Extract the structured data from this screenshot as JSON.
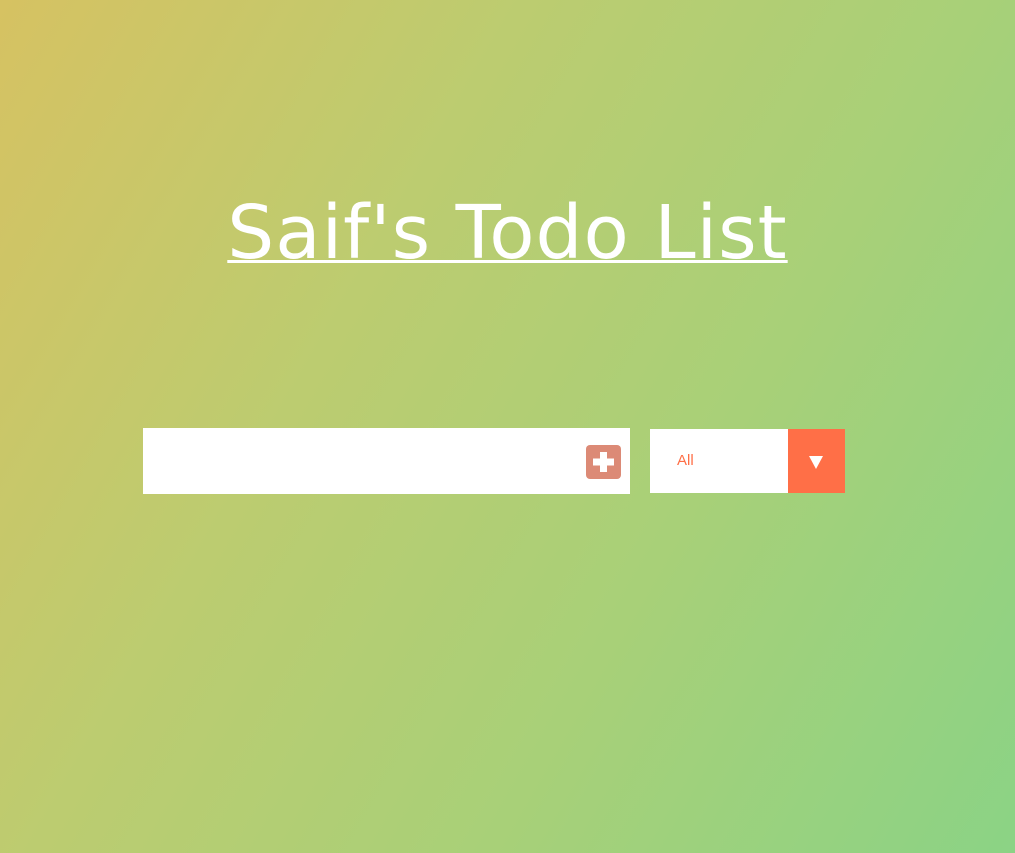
{
  "header": {
    "title": "Saif's Todo List"
  },
  "todo_form": {
    "input_value": "",
    "input_placeholder": "",
    "add_icon": "plus-square-icon"
  },
  "filter": {
    "selected": "All",
    "arrow_icon": "caret-down-icon"
  },
  "colors": {
    "accent": "#ff6f47",
    "add_button": "#dc8a76",
    "gradient_start": "#d6c262",
    "gradient_end": "#8bd385"
  }
}
